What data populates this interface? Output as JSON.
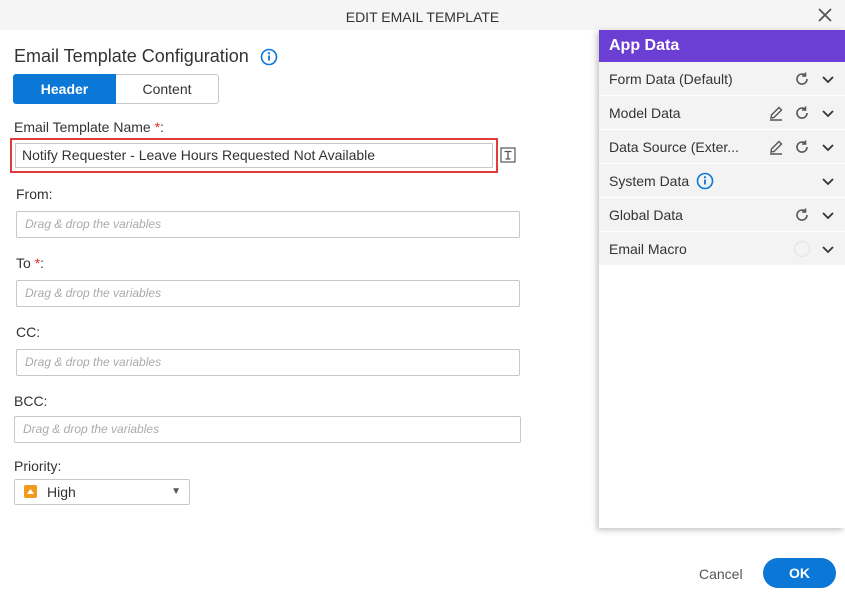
{
  "dialog": {
    "title": "EDIT EMAIL TEMPLATE"
  },
  "section": {
    "title": "Email Template Configuration"
  },
  "tabs": [
    {
      "label": "Header"
    },
    {
      "label": "Content"
    }
  ],
  "form": {
    "name_label": "Email Template Name",
    "name_value": "Notify Requester - Leave Hours Requested Not Available",
    "from_label": "From:",
    "to_label": "To",
    "cc_label": "CC:",
    "bcc_label": "BCC:",
    "priority_label": "Priority:",
    "placeholder": "Drag & drop the variables",
    "priority_value": "High",
    "required_mark": "*"
  },
  "app_data": {
    "title": "App Data",
    "items": [
      {
        "label": "Form Data (Default)"
      },
      {
        "label": "Model Data"
      },
      {
        "label": "Data Source (Exter..."
      },
      {
        "label": "System Data"
      },
      {
        "label": "Global Data"
      },
      {
        "label": "Email Macro"
      }
    ]
  },
  "footer": {
    "cancel": "Cancel",
    "ok": "OK"
  },
  "colors": {
    "accent": "#0b77d6",
    "panel_header": "#6b3fd4",
    "required": "#e02b2b",
    "priority": "#f29a1e"
  }
}
